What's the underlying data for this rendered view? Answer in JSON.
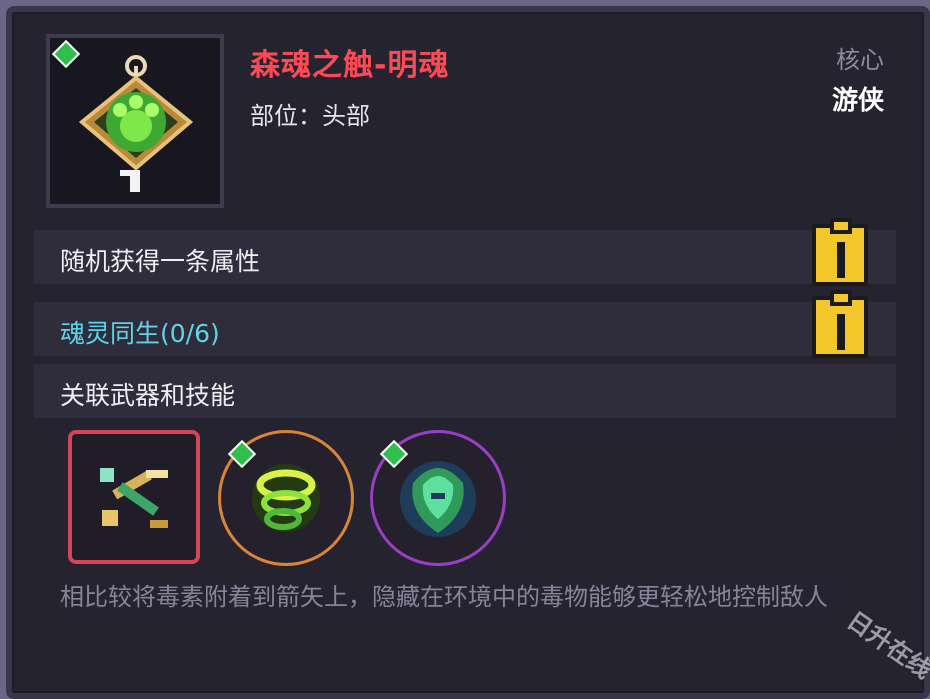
{
  "item": {
    "name": "森魂之触-明魂",
    "slot_text": "部位：头部",
    "core_label": "核心",
    "class_label": "游侠",
    "icon": "green-soul-gem-icon",
    "rarity_badge": "green-gem-badge-icon"
  },
  "rows": {
    "random_attr": "随机获得一条属性",
    "soul_set": "魂灵同生(0/6)",
    "related": "关联武器和技能"
  },
  "related_items": [
    {
      "name": "weapon-crossbow-icon",
      "frame_color": "#d44555"
    },
    {
      "name": "skill-green-vortex-icon",
      "frame_color": "#d8843a"
    },
    {
      "name": "skill-green-claw-icon",
      "frame_color": "#9a3fc4"
    }
  ],
  "description": "相比较将毒素附着到箭矢上，隐藏在环境中的毒物能够更轻松地控制敌人",
  "watermark": "日升在线",
  "colors": {
    "title": "#ff4a55",
    "set_text": "#5fd4e8",
    "info_button": "#f3c62b"
  }
}
